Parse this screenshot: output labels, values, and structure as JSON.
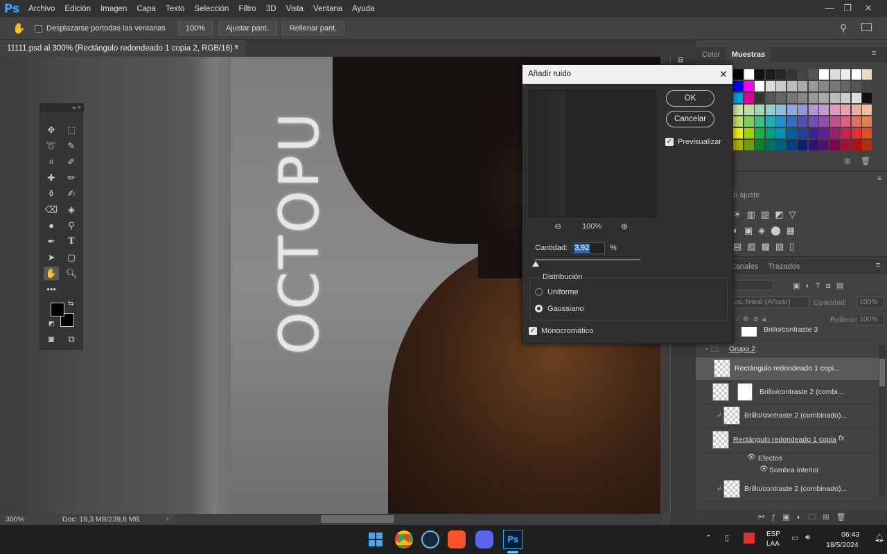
{
  "menubar": {
    "logo": "Ps",
    "items": [
      "Archivo",
      "Edición",
      "Imagen",
      "Capa",
      "Texto",
      "Selección",
      "Filtro",
      "3D",
      "Vista",
      "Ventana",
      "Ayuda"
    ]
  },
  "options": {
    "scroll_all_label": "Desplazarse portodas las ventanas",
    "zoom_btn": "100%",
    "fit_btn": "Ajustar pant.",
    "fill_btn": "Rellenar pant."
  },
  "document": {
    "tab_title": "11111.psd al 300% (Rectángulo redondeado 1 copia 2, RGB/16) *",
    "canvas_text": "OCTOPU"
  },
  "status": {
    "zoom": "300%",
    "doc": "Doc: 18,3 MB/239,8 MB"
  },
  "dialog": {
    "title": "Añadir ruido",
    "ok": "OK",
    "cancel": "Cancelar",
    "preview_label": "Previsualizar",
    "zoom": "100%",
    "amount_label": "Cantidad:",
    "amount_value": "3,92",
    "amount_unit": "%",
    "amount_fraction": 0.0098,
    "distribution_label": "Distribución",
    "uniform": "Uniforme",
    "gaussian": "Gaussiano",
    "monochrome": "Monocromático"
  },
  "right_panel": {
    "color_tab": "Color",
    "swatches_tab": "Muestras",
    "adjust_title": "n ajuste",
    "channels_tab": "Canales",
    "paths_tab": "Trazados",
    "blend_mode": "os. lineal (Añadir)",
    "opacity_label": "Opacidad:",
    "opacity_value": "100%",
    "fill_label": "Relleno:",
    "fill_value": "100%",
    "layers": [
      {
        "name": "Brillo/contraste 3"
      },
      {
        "name": "Grupo 2"
      },
      {
        "name": "Rectángulo redondeado 1 copi..."
      },
      {
        "name": "Brillo/contraste 2 (combi..."
      },
      {
        "name": "Brillo/contraste 2 (combinado)..."
      },
      {
        "name": "Rectángulo redondeado 1 copia"
      },
      {
        "name": "Efectos"
      },
      {
        "name": "Sombra interior"
      },
      {
        "name": "Brillo/contraste 2 (combinado)..."
      }
    ]
  },
  "swatch_colors": [
    [
      "#000000",
      "#ffffff",
      "#111111",
      "#1c1c1c",
      "#272727",
      "#333333",
      "#444444",
      "#555555",
      "#ffffff",
      "#dddddd",
      "#eeeeee",
      "#ffffff",
      "#e8dcc0"
    ],
    [
      "#0000ff",
      "#ff00ff",
      "#ffffff",
      "#dddddd",
      "#cccccc",
      "#bbbbbb",
      "#aaaaaa",
      "#999999",
      "#888888",
      "#777777",
      "#666666",
      "#555555",
      "#444444"
    ],
    [
      "#00a0e0",
      "#e00090",
      "#333333",
      "#555555",
      "#666666",
      "#777777",
      "#888888",
      "#999999",
      "#aaaaaa",
      "#bbbbbb",
      "#cccccc",
      "#dddddd",
      "#111111"
    ],
    [
      "#d0e8a0",
      "#b8e0a0",
      "#a0d8b0",
      "#90d0d0",
      "#90c0e0",
      "#90a8e0",
      "#9898d8",
      "#b098d8",
      "#c898d0",
      "#e098c0",
      "#f0a0b0",
      "#f0b0a0",
      "#f0c0a0"
    ],
    [
      "#c0e060",
      "#80d060",
      "#40c080",
      "#20b0b0",
      "#2090d0",
      "#3070c0",
      "#5050b0",
      "#7050b0",
      "#9050b0",
      "#c05090",
      "#e06080",
      "#e07060",
      "#e08050"
    ],
    [
      "#f0f000",
      "#a0d000",
      "#20b040",
      "#00a080",
      "#0090b0",
      "#0060a0",
      "#2040a0",
      "#402090",
      "#602090",
      "#a02070",
      "#d02050",
      "#e03030",
      "#e05020"
    ],
    [
      "#b0b000",
      "#70a000",
      "#108030",
      "#007060",
      "#006080",
      "#004080",
      "#102070",
      "#301070",
      "#501070",
      "#800050",
      "#a01030",
      "#b01010",
      "#b03010"
    ]
  ],
  "icons": [
    "hand-icon",
    "search-icon",
    "workspace-icon"
  ],
  "taskbar": {
    "lang1": "ESP",
    "lang2": "LAA",
    "time": "06:43",
    "date": "18/5/2024"
  }
}
